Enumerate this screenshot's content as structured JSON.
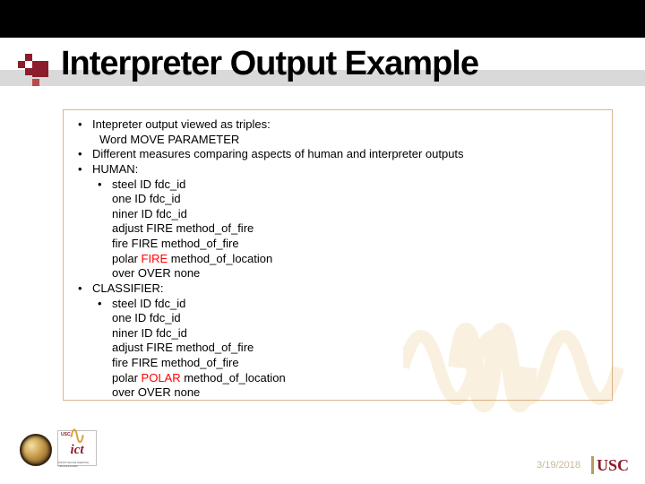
{
  "title": "Interpreter Output Example",
  "bullets": {
    "b1": "Intepreter output viewed as triples:",
    "b1_sub": "Word MOVE PARAMETER",
    "b2": "Different measures comparing aspects of human and interpreter outputs",
    "b3": "HUMAN:",
    "b3_sub": "steel ID fdc_id",
    "b3_l1": "one ID fdc_id",
    "b3_l2": "niner ID fdc_id",
    "b3_l3": "adjust FIRE method_of_fire",
    "b3_l4": "fire FIRE method_of_fire",
    "b3_l5a": "polar ",
    "b3_l5b": "FIRE",
    "b3_l5c": " method_of_location",
    "b3_l6": "over OVER none",
    "b4": "CLASSIFIER:",
    "b4_sub": "steel ID fdc_id",
    "b4_l1": "one ID fdc_id",
    "b4_l2": " niner ID fdc_id",
    "b4_l3": "adjust FIRE method_of_fire",
    "b4_l4": "fire FIRE method_of_fire",
    "b4_l5a": " polar ",
    "b4_l5b": "POLAR",
    "b4_l5c": " method_of_location",
    "b4_l6": "over OVER none"
  },
  "footer": {
    "date": "3/19/2018",
    "usc": "USC",
    "ict": "ict"
  }
}
